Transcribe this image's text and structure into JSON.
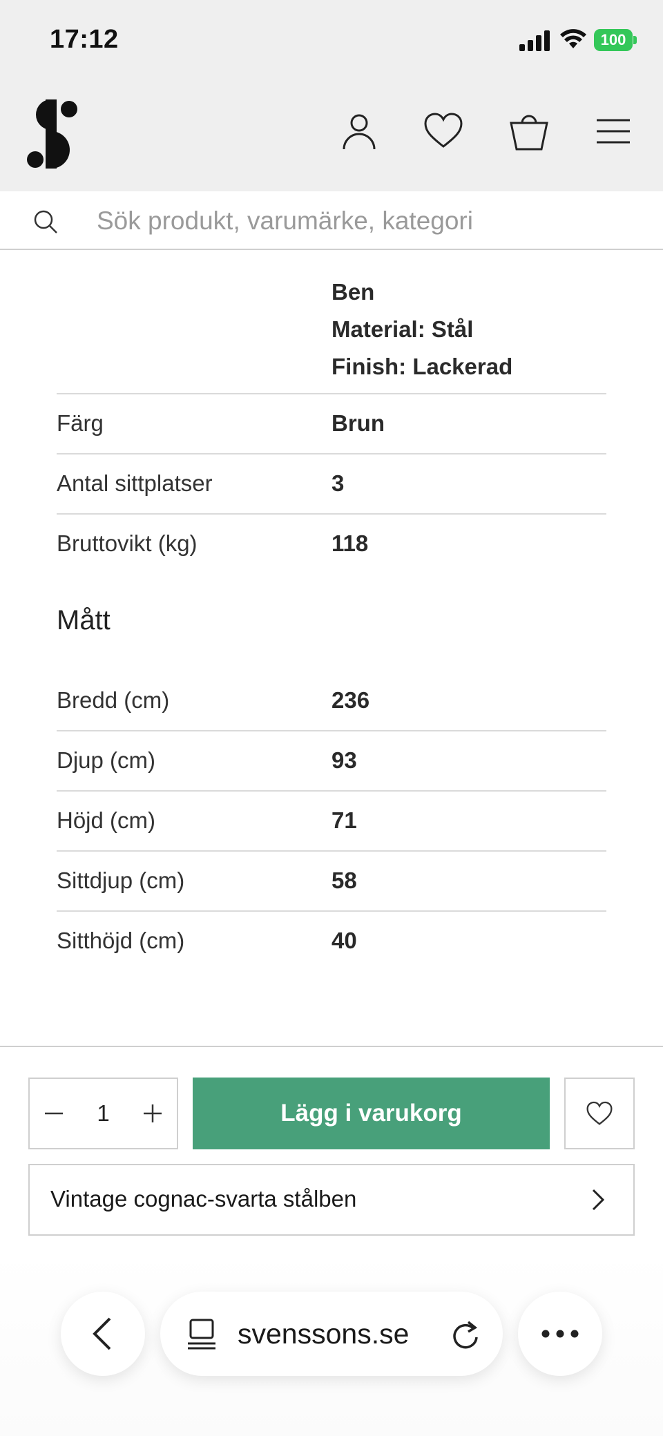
{
  "status_bar": {
    "time": "17:12",
    "battery_level": "100",
    "battery_color": "#34c759"
  },
  "header": {
    "logo": "S",
    "icons": [
      "account-icon",
      "heart-icon",
      "cart-icon",
      "menu-icon"
    ],
    "background": "#efefef"
  },
  "search": {
    "placeholder": "Sök produkt, varumärke, kategori"
  },
  "specs": {
    "legs_lines": [
      "Ben",
      "Material: Stål",
      "Finish: Lackerad"
    ],
    "rows": [
      {
        "label": "Färg",
        "value": "Brun"
      },
      {
        "label": "Antal sittplatser",
        "value": "3"
      },
      {
        "label": "Bruttovikt (kg)",
        "value": "118"
      }
    ]
  },
  "dimensions": {
    "title": "Mått",
    "rows": [
      {
        "label": "Bredd (cm)",
        "value": "236"
      },
      {
        "label": "Djup (cm)",
        "value": "93"
      },
      {
        "label": "Höjd (cm)",
        "value": "71"
      },
      {
        "label": "Sittdjup (cm)",
        "value": "58"
      },
      {
        "label": "Sitthöjd (cm)",
        "value": "40"
      }
    ]
  },
  "purchase": {
    "quantity": "1",
    "add_to_cart_label": "Lägg i varukorg",
    "accent_color": "#48a07a",
    "variant_label": "Vintage cognac-svarta stålben"
  },
  "browser": {
    "url": "svenssons.se"
  }
}
